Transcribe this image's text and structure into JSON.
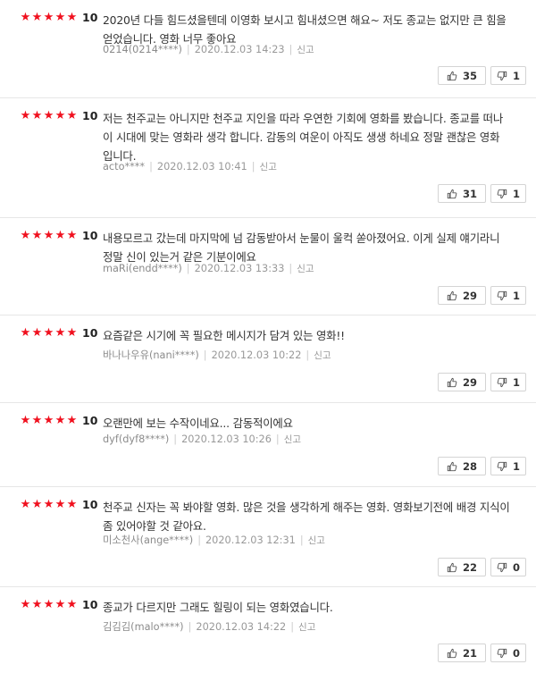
{
  "reviews": [
    {
      "stars": 5,
      "score": "10",
      "text": "2020년 다들 힘드셨을텐데 이영화 보시고 힘내셨으면 해요~ 저도 종교는 없지만 큰 힘을 얻었습니다. 영화 너무 좋아요",
      "author": "0214(0214****)",
      "date": "2020.12.03 14:23",
      "report": "신고",
      "likes": "35",
      "dislikes": "1"
    },
    {
      "stars": 5,
      "score": "10",
      "text": "저는 천주교는 아니지만 천주교 지인을 따라 우연한 기회에 영화를 봤습니다. 종교를 떠나 이 시대에 맞는 영화라 생각 합니다. 감동의 여운이 아직도 생생 하네요 정말 괜찮은 영화 입니다.",
      "author": "acto****",
      "date": "2020.12.03 10:41",
      "report": "신고",
      "likes": "31",
      "dislikes": "1"
    },
    {
      "stars": 5,
      "score": "10",
      "text": "내용모르고 갔는데 마지막에 넘 감동받아서 눈물이 울컥 쏟아졌어요. 이게 실제 얘기라니 정말 신이 있는거 같은 기분이에요",
      "author": "maRi(endd****)",
      "date": "2020.12.03 13:33",
      "report": "신고",
      "likes": "29",
      "dislikes": "1"
    },
    {
      "stars": 5,
      "score": "10",
      "text": "요즘같은 시기에 꼭 필요한 메시지가 담겨 있는 영화!!",
      "author": "바나나우유(nani****)",
      "date": "2020.12.03 10:22",
      "report": "신고",
      "likes": "29",
      "dislikes": "1"
    },
    {
      "stars": 5,
      "score": "10",
      "text": "오랜만에 보는 수작이네요... 감동적이에요",
      "author": "dyf(dyf8****)",
      "date": "2020.12.03 10:26",
      "report": "신고",
      "likes": "28",
      "dislikes": "1"
    },
    {
      "stars": 5,
      "score": "10",
      "text": "천주교 신자는 꼭 봐야할 영화. 많은 것을 생각하게 해주는 영화. 영화보기전에 배경 지식이 좀 있어야할 것 같아요.",
      "author": "미소천사(ange****)",
      "date": "2020.12.03 12:31",
      "report": "신고",
      "likes": "22",
      "dislikes": "0"
    },
    {
      "stars": 5,
      "score": "10",
      "text": "종교가 다르지만 그래도 힐링이 되는 영화였습니다.",
      "author": "김김김(malo****)",
      "date": "2020.12.03 14:22",
      "report": "신고",
      "likes": "21",
      "dislikes": "0"
    }
  ]
}
